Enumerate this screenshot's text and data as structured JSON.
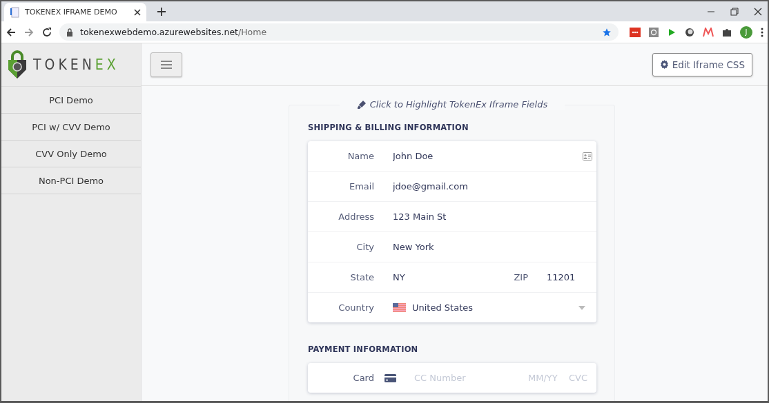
{
  "browser": {
    "tab_title": "TOKENEX IFRAME DEMO",
    "url_host": "tokenexwebdemo.azurewebsites.net",
    "url_path": "/Home",
    "avatar_letter": "J"
  },
  "sidebar": {
    "logo": [
      {
        "text": "TOKEN",
        "accent": false
      },
      {
        "text": "EX",
        "accent": true
      }
    ],
    "items": [
      {
        "label": "PCI Demo"
      },
      {
        "label": "PCI w/ CVV Demo"
      },
      {
        "label": "CVV Only Demo"
      },
      {
        "label": "Non-PCI Demo"
      }
    ]
  },
  "header": {
    "edit_button": "Edit Iframe CSS"
  },
  "highlight_link": "Click to Highlight TokenEx Iframe Fields",
  "sections": [
    {
      "title": "SHIPPING & BILLING INFORMATION",
      "rows": [
        {
          "kind": "text",
          "label": "Name",
          "value": "John Doe",
          "contact_icon": true
        },
        {
          "kind": "text",
          "label": "Email",
          "value": "jdoe@gmail.com",
          "contact_icon": false
        },
        {
          "kind": "text",
          "label": "Address",
          "value": "123 Main St",
          "contact_icon": false
        },
        {
          "kind": "text",
          "label": "City",
          "value": "New York",
          "contact_icon": false
        },
        {
          "kind": "pair",
          "label": "State",
          "value": "NY",
          "label2": "ZIP",
          "value2": "11201"
        },
        {
          "kind": "select",
          "label": "Country",
          "value": "United States"
        }
      ]
    },
    {
      "title": "PAYMENT INFORMATION",
      "rows": [
        {
          "kind": "card",
          "label": "Card",
          "placeholder": "CC Number",
          "expiry_placeholder": "MM/YY",
          "cvc_placeholder": "CVC"
        }
      ]
    }
  ]
}
